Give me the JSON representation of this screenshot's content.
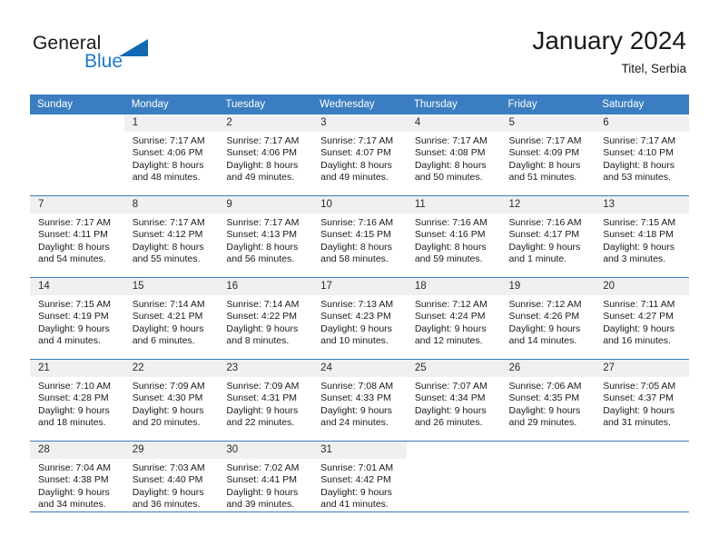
{
  "brand": {
    "name_part1": "General",
    "name_part2": "Blue",
    "triangle_color": "#1268b3",
    "blue_text_color": "#1f7ac4"
  },
  "header": {
    "title": "January 2024",
    "subtitle": "Titel, Serbia"
  },
  "colors": {
    "header_blue": "#3a7dc0",
    "daynum_band": "#f0f0f0",
    "text": "#1a1a1a"
  },
  "weekdays": [
    "Sunday",
    "Monday",
    "Tuesday",
    "Wednesday",
    "Thursday",
    "Friday",
    "Saturday"
  ],
  "weeks": [
    [
      {
        "day": "",
        "sunrise": "",
        "sunset": "",
        "daylight_a": "",
        "daylight_b": ""
      },
      {
        "day": "1",
        "sunrise": "Sunrise: 7:17 AM",
        "sunset": "Sunset: 4:06 PM",
        "daylight_a": "Daylight: 8 hours",
        "daylight_b": "and 48 minutes."
      },
      {
        "day": "2",
        "sunrise": "Sunrise: 7:17 AM",
        "sunset": "Sunset: 4:06 PM",
        "daylight_a": "Daylight: 8 hours",
        "daylight_b": "and 49 minutes."
      },
      {
        "day": "3",
        "sunrise": "Sunrise: 7:17 AM",
        "sunset": "Sunset: 4:07 PM",
        "daylight_a": "Daylight: 8 hours",
        "daylight_b": "and 49 minutes."
      },
      {
        "day": "4",
        "sunrise": "Sunrise: 7:17 AM",
        "sunset": "Sunset: 4:08 PM",
        "daylight_a": "Daylight: 8 hours",
        "daylight_b": "and 50 minutes."
      },
      {
        "day": "5",
        "sunrise": "Sunrise: 7:17 AM",
        "sunset": "Sunset: 4:09 PM",
        "daylight_a": "Daylight: 8 hours",
        "daylight_b": "and 51 minutes."
      },
      {
        "day": "6",
        "sunrise": "Sunrise: 7:17 AM",
        "sunset": "Sunset: 4:10 PM",
        "daylight_a": "Daylight: 8 hours",
        "daylight_b": "and 53 minutes."
      }
    ],
    [
      {
        "day": "7",
        "sunrise": "Sunrise: 7:17 AM",
        "sunset": "Sunset: 4:11 PM",
        "daylight_a": "Daylight: 8 hours",
        "daylight_b": "and 54 minutes."
      },
      {
        "day": "8",
        "sunrise": "Sunrise: 7:17 AM",
        "sunset": "Sunset: 4:12 PM",
        "daylight_a": "Daylight: 8 hours",
        "daylight_b": "and 55 minutes."
      },
      {
        "day": "9",
        "sunrise": "Sunrise: 7:17 AM",
        "sunset": "Sunset: 4:13 PM",
        "daylight_a": "Daylight: 8 hours",
        "daylight_b": "and 56 minutes."
      },
      {
        "day": "10",
        "sunrise": "Sunrise: 7:16 AM",
        "sunset": "Sunset: 4:15 PM",
        "daylight_a": "Daylight: 8 hours",
        "daylight_b": "and 58 minutes."
      },
      {
        "day": "11",
        "sunrise": "Sunrise: 7:16 AM",
        "sunset": "Sunset: 4:16 PM",
        "daylight_a": "Daylight: 8 hours",
        "daylight_b": "and 59 minutes."
      },
      {
        "day": "12",
        "sunrise": "Sunrise: 7:16 AM",
        "sunset": "Sunset: 4:17 PM",
        "daylight_a": "Daylight: 9 hours",
        "daylight_b": "and 1 minute."
      },
      {
        "day": "13",
        "sunrise": "Sunrise: 7:15 AM",
        "sunset": "Sunset: 4:18 PM",
        "daylight_a": "Daylight: 9 hours",
        "daylight_b": "and 3 minutes."
      }
    ],
    [
      {
        "day": "14",
        "sunrise": "Sunrise: 7:15 AM",
        "sunset": "Sunset: 4:19 PM",
        "daylight_a": "Daylight: 9 hours",
        "daylight_b": "and 4 minutes."
      },
      {
        "day": "15",
        "sunrise": "Sunrise: 7:14 AM",
        "sunset": "Sunset: 4:21 PM",
        "daylight_a": "Daylight: 9 hours",
        "daylight_b": "and 6 minutes."
      },
      {
        "day": "16",
        "sunrise": "Sunrise: 7:14 AM",
        "sunset": "Sunset: 4:22 PM",
        "daylight_a": "Daylight: 9 hours",
        "daylight_b": "and 8 minutes."
      },
      {
        "day": "17",
        "sunrise": "Sunrise: 7:13 AM",
        "sunset": "Sunset: 4:23 PM",
        "daylight_a": "Daylight: 9 hours",
        "daylight_b": "and 10 minutes."
      },
      {
        "day": "18",
        "sunrise": "Sunrise: 7:12 AM",
        "sunset": "Sunset: 4:24 PM",
        "daylight_a": "Daylight: 9 hours",
        "daylight_b": "and 12 minutes."
      },
      {
        "day": "19",
        "sunrise": "Sunrise: 7:12 AM",
        "sunset": "Sunset: 4:26 PM",
        "daylight_a": "Daylight: 9 hours",
        "daylight_b": "and 14 minutes."
      },
      {
        "day": "20",
        "sunrise": "Sunrise: 7:11 AM",
        "sunset": "Sunset: 4:27 PM",
        "daylight_a": "Daylight: 9 hours",
        "daylight_b": "and 16 minutes."
      }
    ],
    [
      {
        "day": "21",
        "sunrise": "Sunrise: 7:10 AM",
        "sunset": "Sunset: 4:28 PM",
        "daylight_a": "Daylight: 9 hours",
        "daylight_b": "and 18 minutes."
      },
      {
        "day": "22",
        "sunrise": "Sunrise: 7:09 AM",
        "sunset": "Sunset: 4:30 PM",
        "daylight_a": "Daylight: 9 hours",
        "daylight_b": "and 20 minutes."
      },
      {
        "day": "23",
        "sunrise": "Sunrise: 7:09 AM",
        "sunset": "Sunset: 4:31 PM",
        "daylight_a": "Daylight: 9 hours",
        "daylight_b": "and 22 minutes."
      },
      {
        "day": "24",
        "sunrise": "Sunrise: 7:08 AM",
        "sunset": "Sunset: 4:33 PM",
        "daylight_a": "Daylight: 9 hours",
        "daylight_b": "and 24 minutes."
      },
      {
        "day": "25",
        "sunrise": "Sunrise: 7:07 AM",
        "sunset": "Sunset: 4:34 PM",
        "daylight_a": "Daylight: 9 hours",
        "daylight_b": "and 26 minutes."
      },
      {
        "day": "26",
        "sunrise": "Sunrise: 7:06 AM",
        "sunset": "Sunset: 4:35 PM",
        "daylight_a": "Daylight: 9 hours",
        "daylight_b": "and 29 minutes."
      },
      {
        "day": "27",
        "sunrise": "Sunrise: 7:05 AM",
        "sunset": "Sunset: 4:37 PM",
        "daylight_a": "Daylight: 9 hours",
        "daylight_b": "and 31 minutes."
      }
    ],
    [
      {
        "day": "28",
        "sunrise": "Sunrise: 7:04 AM",
        "sunset": "Sunset: 4:38 PM",
        "daylight_a": "Daylight: 9 hours",
        "daylight_b": "and 34 minutes."
      },
      {
        "day": "29",
        "sunrise": "Sunrise: 7:03 AM",
        "sunset": "Sunset: 4:40 PM",
        "daylight_a": "Daylight: 9 hours",
        "daylight_b": "and 36 minutes."
      },
      {
        "day": "30",
        "sunrise": "Sunrise: 7:02 AM",
        "sunset": "Sunset: 4:41 PM",
        "daylight_a": "Daylight: 9 hours",
        "daylight_b": "and 39 minutes."
      },
      {
        "day": "31",
        "sunrise": "Sunrise: 7:01 AM",
        "sunset": "Sunset: 4:42 PM",
        "daylight_a": "Daylight: 9 hours",
        "daylight_b": "and 41 minutes."
      },
      {
        "day": "",
        "sunrise": "",
        "sunset": "",
        "daylight_a": "",
        "daylight_b": ""
      },
      {
        "day": "",
        "sunrise": "",
        "sunset": "",
        "daylight_a": "",
        "daylight_b": ""
      },
      {
        "day": "",
        "sunrise": "",
        "sunset": "",
        "daylight_a": "",
        "daylight_b": ""
      }
    ]
  ]
}
